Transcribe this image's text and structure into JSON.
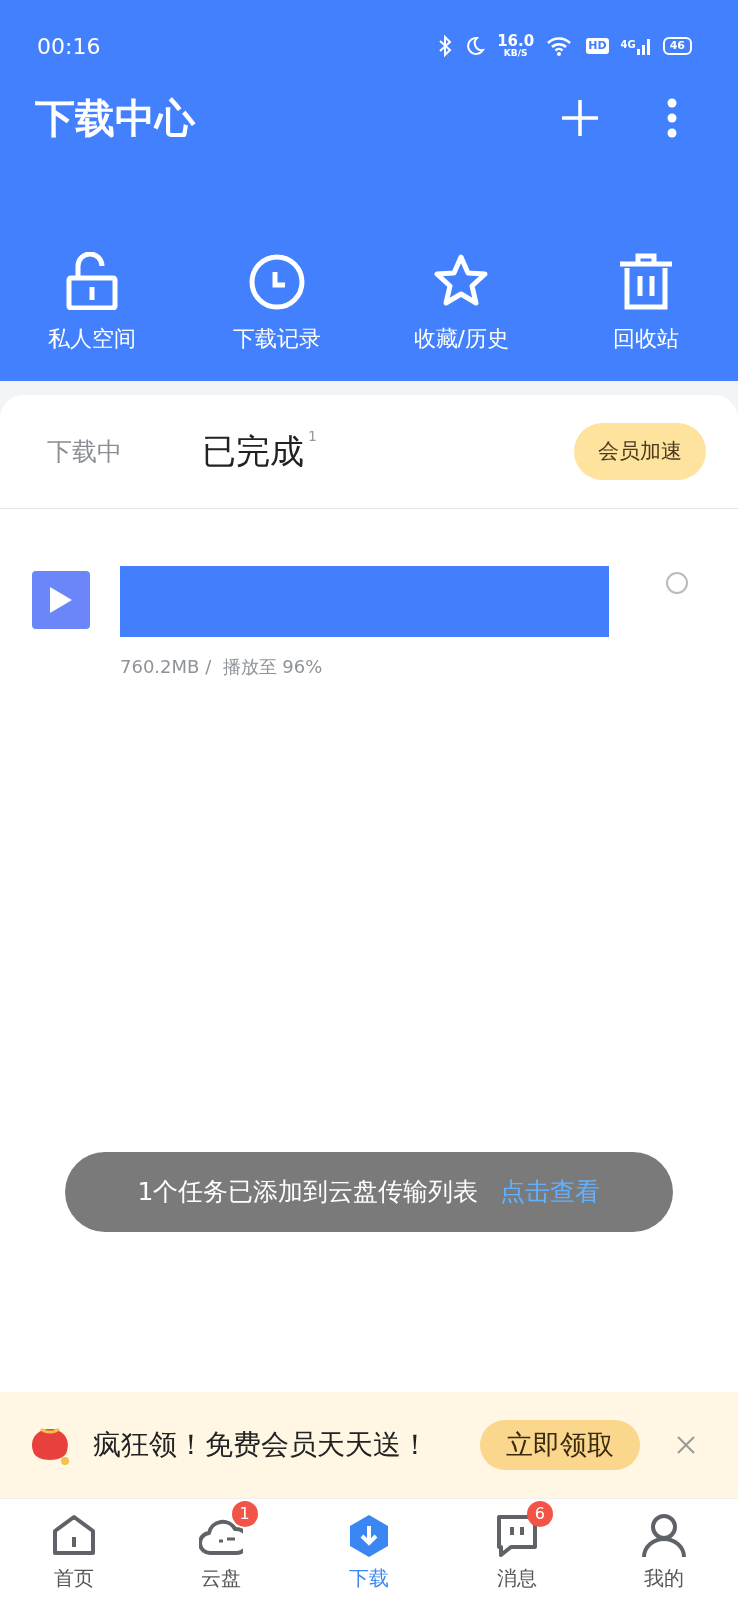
{
  "status_bar": {
    "time": "00:16",
    "speed": "16.0",
    "speed_unit": "KB/S",
    "hd": "HD",
    "network": "4G",
    "battery": "46"
  },
  "header": {
    "title": "下载中心"
  },
  "quick_actions": [
    {
      "kind": "lock",
      "label": "私人空间"
    },
    {
      "kind": "clock",
      "label": "下载记录"
    },
    {
      "kind": "star",
      "label": "收藏/历史"
    },
    {
      "kind": "trash",
      "label": "回收站"
    }
  ],
  "tabs": [
    {
      "label": "下载中",
      "selected": false
    },
    {
      "label": "已完成",
      "selected": true,
      "count": "1"
    }
  ],
  "vip_button": "会员加速",
  "files": [
    {
      "info": "760.2MB /  播放至 96%",
      "selected": false
    }
  ],
  "toast": {
    "message": "1个任务已添加到云盘传输列表",
    "action": "点击查看"
  },
  "banner": {
    "text": "疯狂领！免费会员天天送！",
    "button": "立即领取"
  },
  "nav": [
    {
      "kind": "home",
      "label": "首页",
      "selected": false
    },
    {
      "kind": "cloud",
      "label": "云盘",
      "selected": false,
      "badge": "1"
    },
    {
      "kind": "download",
      "label": "下载",
      "selected": true
    },
    {
      "kind": "message",
      "label": "消息",
      "selected": false,
      "badge": "6"
    },
    {
      "kind": "user",
      "label": "我的",
      "selected": false
    }
  ]
}
